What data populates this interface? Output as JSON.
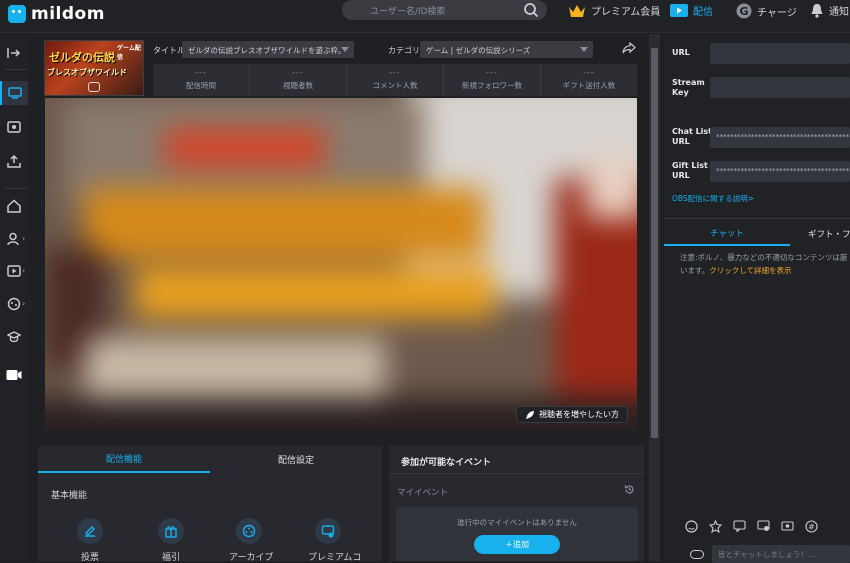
{
  "app": {
    "name": "mildom"
  },
  "topbar": {
    "search_placeholder": "ユーザー名/ID検索",
    "premium": "プレミアム会員",
    "live": "配信",
    "charge": "チャージ",
    "notify": "通知"
  },
  "stream": {
    "title_label": "タイトル",
    "title_value": "ゼルダの伝説ブレスオブザワイルドを遊ぶ枠。",
    "category_label": "カテゴリー",
    "category_value": "ゲーム | ゼルダの伝説シリーズ",
    "thumb_text1": "ゼルダの伝説",
    "thumb_text2": "ブレスオブザワイルド",
    "thumb_tag": "ゲーム配信",
    "stats": [
      {
        "value": "---",
        "label": "配信時間"
      },
      {
        "value": "---",
        "label": "視聴者数"
      },
      {
        "value": "---",
        "label": "コメント人数"
      },
      {
        "value": "---",
        "label": "新規フォロワー数"
      },
      {
        "value": "---",
        "label": "ギフト送付人数"
      }
    ],
    "boost_button": "視聴者を増やしたい方"
  },
  "panel": {
    "tab_features": "配信機能",
    "tab_settings": "配信設定",
    "basic": "基本機能",
    "features": [
      "投票",
      "福引",
      "アーカイブ",
      "プレミアムコ"
    ]
  },
  "events": {
    "title": "参加が可能なイベント",
    "my_events": "マイイベント",
    "none": "進行中のマイイベントはありません",
    "add": "＋追加"
  },
  "right": {
    "url_label": "URL",
    "key_label": "Stream\nKey",
    "chat_label": "Chat List\nURL",
    "chat_value": "******************************************",
    "gift_label": "Gift List\nURL",
    "gift_value": "******************************************",
    "obs_link": "OBS配信に関する説明>",
    "tab_chat": "チャット",
    "tab_gift": "ギフト・ファ",
    "notice": "注意:ポルノ、暴力などの不適切なコンテンツは厳",
    "notice2": "います。",
    "notice_link": "クリックして詳細を表示",
    "chat_placeholder": "皆とチャットしましょう！…"
  },
  "colors": {
    "accent": "#19b0ee",
    "bg": "#1f2023",
    "panel": "#27292e"
  }
}
